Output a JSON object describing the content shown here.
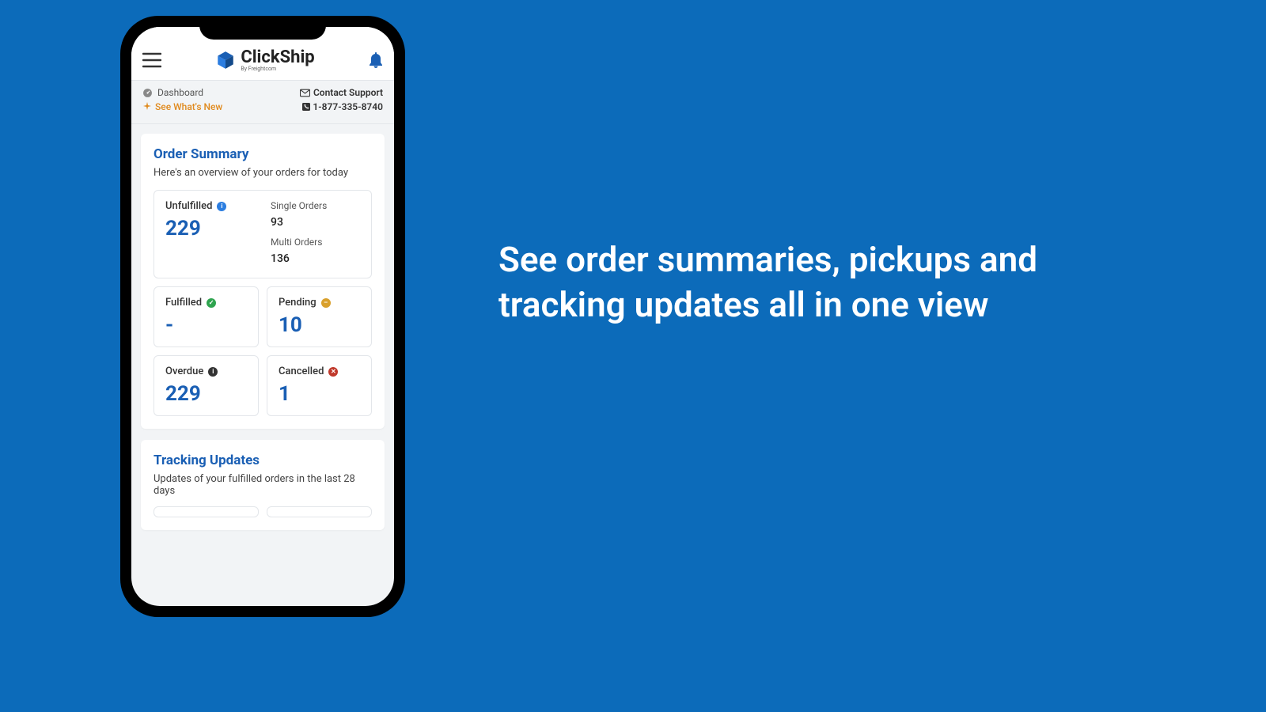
{
  "marketing_headline": "See order summaries, pickups and tracking updates all in one view",
  "header": {
    "logo_text": "ClickShip",
    "logo_sub": "By Freightcom"
  },
  "breadcrumb": {
    "dashboard": "Dashboard",
    "whats_new": "See What's New",
    "contact": "Contact Support",
    "phone": "1-877-335-8740"
  },
  "order_summary": {
    "title": "Order Summary",
    "subtitle": "Here's an overview of your orders for today",
    "unfulfilled": {
      "label": "Unfulfilled",
      "value": "229"
    },
    "single_orders": {
      "label": "Single Orders",
      "value": "93"
    },
    "multi_orders": {
      "label": "Multi Orders",
      "value": "136"
    },
    "fulfilled": {
      "label": "Fulfilled",
      "value": "-"
    },
    "pending": {
      "label": "Pending",
      "value": "10"
    },
    "overdue": {
      "label": "Overdue",
      "value": "229"
    },
    "cancelled": {
      "label": "Cancelled",
      "value": "1"
    }
  },
  "tracking": {
    "title": "Tracking Updates",
    "subtitle": "Updates of your fulfilled orders in the last 28 days"
  }
}
